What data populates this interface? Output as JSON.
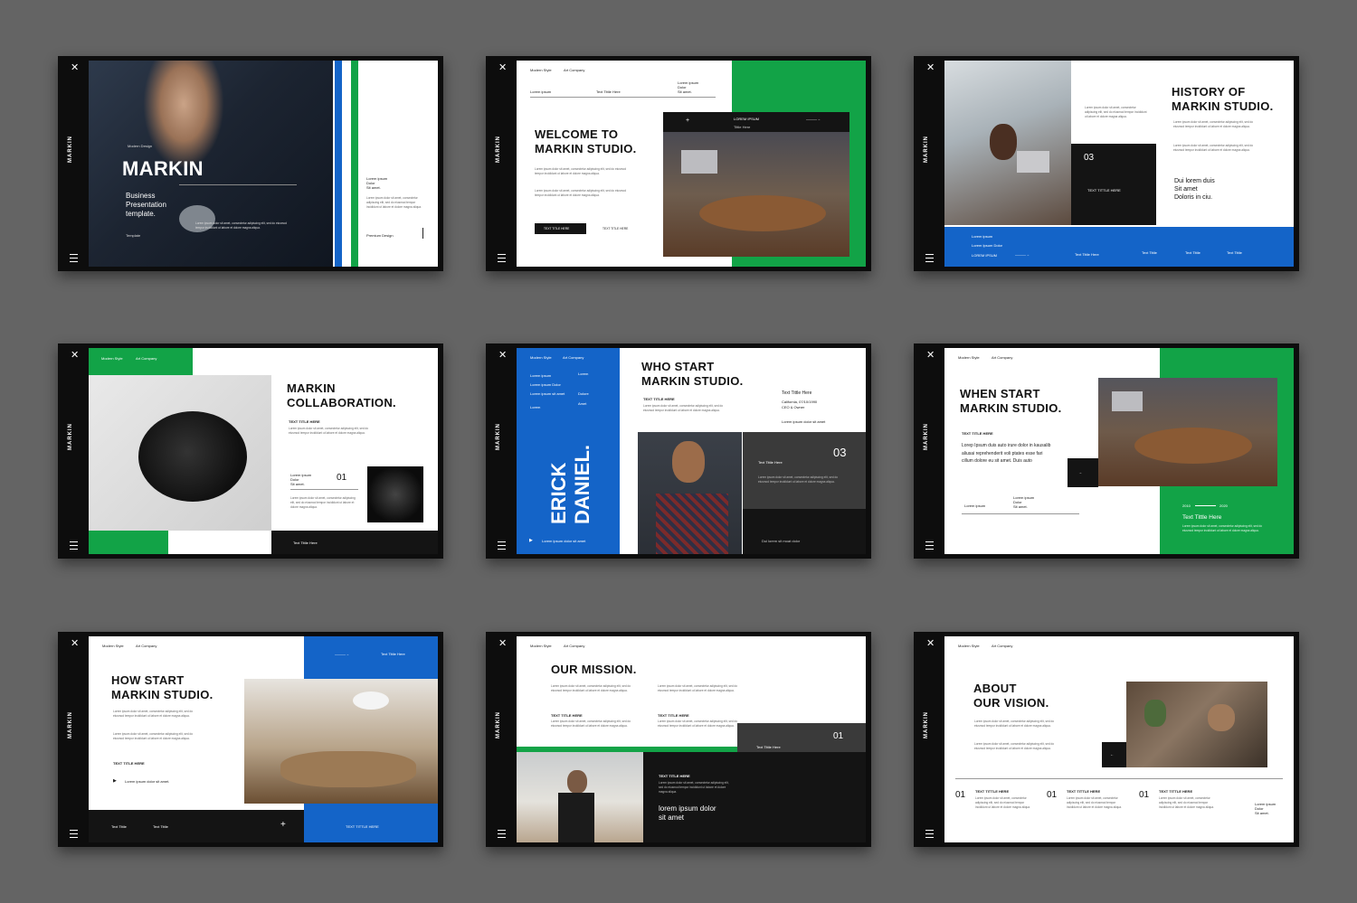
{
  "colors": {
    "background": "#646464",
    "green": "#12a347",
    "blue": "#1464c8",
    "dark": "#141414"
  },
  "rail": {
    "close_icon": "✕",
    "brand": "MARKIN",
    "menu_icon": "hamburger-icon"
  },
  "common": {
    "modern_style": "Modern Style",
    "art_company": "Art Company",
    "lorem": "Lorem ipsum dolor sit amet, consectetur adipiscing elit, sed do eiusmod tempor incididunt ut labore et dolore magna aliqua.",
    "text_title": "TEXT TITTLE HERE"
  },
  "s1": {
    "tag": "Modern Design",
    "title": "MARKIN",
    "subtitle_1": "Business",
    "subtitle_2": "Presentation",
    "subtitle_3": "template.",
    "template": "Template",
    "side_1": "Lorem ipsum",
    "side_2": "Dolor",
    "side_3": "Sit amet.",
    "premium": "Premium Design"
  },
  "s2": {
    "title_1": "WELCOME TO",
    "title_2": "MARKIN STUDIO.",
    "lorem_label": "Lorem ipsum",
    "text_title": "Text Tittle Here",
    "col_1": "Lorem ipsum",
    "col_2": "Dolor",
    "col_3": "Sit amet.",
    "banner": "LOREM IPSUM",
    "banner_sub": "Tittle Here",
    "button": "TEXT TITLE HERE",
    "button_2": "TEXT TITLE HERE"
  },
  "s3": {
    "title_1": "HISTORY OF",
    "title_2": "MARKIN STUDIO.",
    "num": "03",
    "box_label": "TEXT TITTLE HERE",
    "quote_1": "Dui lorem duis",
    "quote_2": "Sit amet",
    "quote_3": "Doloris in ciu.",
    "foot_1": "Lorem ipsum",
    "foot_2": "Lorem Ipsum Dolor",
    "foot_3": "LOREM IPSUM",
    "foot_t1": "Text Tittle Here",
    "foot_t2": "Text Tittle",
    "foot_t3": "Text Tittle",
    "foot_t4": "Text Tittle"
  },
  "s4": {
    "title_1": "MARKIN",
    "title_2": "COLLABORATION.",
    "label": "TEXT TITLE HERE",
    "side_1": "Lorem ipsum",
    "side_2": "Dolor",
    "side_3": "Sit amet.",
    "num": "01",
    "foot": "Text Tittle Here"
  },
  "s5": {
    "title_1": "WHO START",
    "title_2": "MARKIN STUDIO.",
    "label": "TEXT TITLE HERE",
    "name_1": "ERICK",
    "name_2": "DANIEL.",
    "menu_1": "Lorem ipsum",
    "menu_2": "Lorem ipsum Dolor",
    "menu_3": "Lorem ipsum sit amet",
    "menu_4": "Lorem",
    "menu_5": "Lorem",
    "menu_6": "Dolore",
    "menu_7": "Amet",
    "info_title": "Text Tittle Here",
    "info_1": "California, 07/10/1990",
    "info_2": "CEO & Owner",
    "info_3": "Lorem ipsum dolor sit amet",
    "num": "03",
    "box_label": "Text Tittle Here",
    "foot": "Lorem ipsum dolor sit amet",
    "foot_2": "Dui lorem sit moat dolor"
  },
  "s6": {
    "title_1": "WHEN START",
    "title_2": "MARKIN STUDIO.",
    "label": "TEXT TITLE HERE",
    "body": "Lorep Ipsum duis auto irure dolor in kausalib aliusai reprehenderit voli ptates esse fari cillum dolore eu sit amet. Duis auto",
    "side_1": "Lorem ipsum",
    "side_2": "Dolor",
    "side_3": "Sit amet.",
    "foot_1": "Lorem ipsum",
    "year_1": "2010",
    "year_2": "2020",
    "green_title": "Text Tittle Here"
  },
  "s7": {
    "title_1": "HOW START",
    "title_2": "MARKIN STUDIO.",
    "label": "TEXT TITLE HERE",
    "bullet": "Lorem ipsum dolor sit amet.",
    "arrow_text": "Text Tittle Here",
    "foot_1": "Text Tittle",
    "foot_2": "Text Tittle",
    "foot_plus": "+",
    "blue_foot": "TEXT TITTLE HERE"
  },
  "s8": {
    "title": "OUR MISSION.",
    "label_1": "TEXT TITLE HERE",
    "label_2": "TEXT TITLE HERE",
    "num": "01",
    "box_label": "Text Tittle Here",
    "dark_label": "TEXT TITLE HERE",
    "dark_1": "lorem ipsum dolor",
    "dark_2": "sit amet"
  },
  "s9": {
    "title_1": "ABOUT",
    "title_2": "OUR VISION.",
    "n1": "01",
    "n2": "01",
    "n3": "01",
    "l1": "TEXT TITTLE HERE",
    "l2": "TEXT TITTLE HERE",
    "l3": "TEXT TITTLE HERE",
    "side_1": "Lorem ipsum",
    "side_2": "Dolor",
    "side_3": "Sit amet."
  }
}
